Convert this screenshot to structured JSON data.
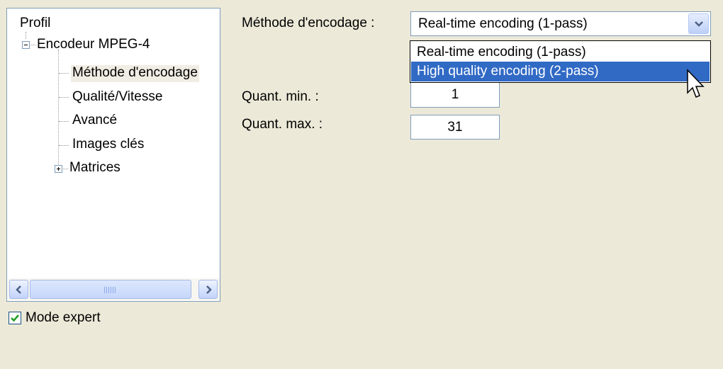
{
  "tree": {
    "root": "Profil",
    "encoder": "Encodeur MPEG-4",
    "items": [
      "Méthode d'encodage",
      "Qualité/Vitesse",
      "Avancé",
      "Images clés",
      "Matrices"
    ]
  },
  "scrollbar": {
    "grip_glyph": "III"
  },
  "expert_mode": {
    "label": "Mode expert",
    "checked": true
  },
  "encoding_method": {
    "label": "Méthode d'encodage :",
    "value": "Real-time encoding (1-pass)",
    "options": [
      "Real-time encoding (1-pass)",
      "High quality encoding (2-pass)"
    ],
    "highlighted_option": "High quality encoding (2-pass)"
  },
  "quant_min": {
    "label": "Quant. min. :",
    "value": "1"
  },
  "quant_max": {
    "label": "Quant. max. :",
    "value": "31"
  }
}
